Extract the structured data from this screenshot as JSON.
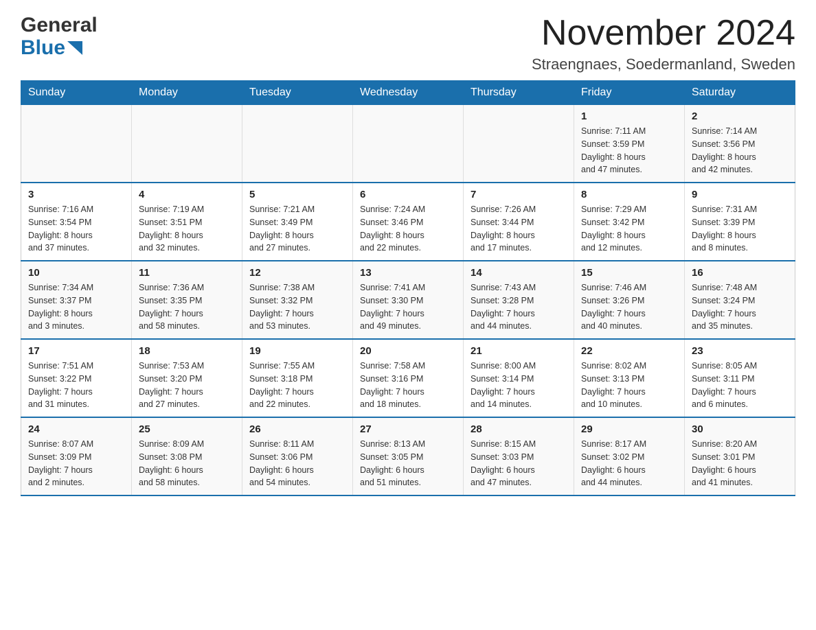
{
  "header": {
    "logo_general": "General",
    "logo_blue": "Blue",
    "month_title": "November 2024",
    "location": "Straengnaes, Soedermanland, Sweden"
  },
  "days_of_week": [
    "Sunday",
    "Monday",
    "Tuesday",
    "Wednesday",
    "Thursday",
    "Friday",
    "Saturday"
  ],
  "weeks": [
    [
      {
        "day": "",
        "info": ""
      },
      {
        "day": "",
        "info": ""
      },
      {
        "day": "",
        "info": ""
      },
      {
        "day": "",
        "info": ""
      },
      {
        "day": "",
        "info": ""
      },
      {
        "day": "1",
        "info": "Sunrise: 7:11 AM\nSunset: 3:59 PM\nDaylight: 8 hours\nand 47 minutes."
      },
      {
        "day": "2",
        "info": "Sunrise: 7:14 AM\nSunset: 3:56 PM\nDaylight: 8 hours\nand 42 minutes."
      }
    ],
    [
      {
        "day": "3",
        "info": "Sunrise: 7:16 AM\nSunset: 3:54 PM\nDaylight: 8 hours\nand 37 minutes."
      },
      {
        "day": "4",
        "info": "Sunrise: 7:19 AM\nSunset: 3:51 PM\nDaylight: 8 hours\nand 32 minutes."
      },
      {
        "day": "5",
        "info": "Sunrise: 7:21 AM\nSunset: 3:49 PM\nDaylight: 8 hours\nand 27 minutes."
      },
      {
        "day": "6",
        "info": "Sunrise: 7:24 AM\nSunset: 3:46 PM\nDaylight: 8 hours\nand 22 minutes."
      },
      {
        "day": "7",
        "info": "Sunrise: 7:26 AM\nSunset: 3:44 PM\nDaylight: 8 hours\nand 17 minutes."
      },
      {
        "day": "8",
        "info": "Sunrise: 7:29 AM\nSunset: 3:42 PM\nDaylight: 8 hours\nand 12 minutes."
      },
      {
        "day": "9",
        "info": "Sunrise: 7:31 AM\nSunset: 3:39 PM\nDaylight: 8 hours\nand 8 minutes."
      }
    ],
    [
      {
        "day": "10",
        "info": "Sunrise: 7:34 AM\nSunset: 3:37 PM\nDaylight: 8 hours\nand 3 minutes."
      },
      {
        "day": "11",
        "info": "Sunrise: 7:36 AM\nSunset: 3:35 PM\nDaylight: 7 hours\nand 58 minutes."
      },
      {
        "day": "12",
        "info": "Sunrise: 7:38 AM\nSunset: 3:32 PM\nDaylight: 7 hours\nand 53 minutes."
      },
      {
        "day": "13",
        "info": "Sunrise: 7:41 AM\nSunset: 3:30 PM\nDaylight: 7 hours\nand 49 minutes."
      },
      {
        "day": "14",
        "info": "Sunrise: 7:43 AM\nSunset: 3:28 PM\nDaylight: 7 hours\nand 44 minutes."
      },
      {
        "day": "15",
        "info": "Sunrise: 7:46 AM\nSunset: 3:26 PM\nDaylight: 7 hours\nand 40 minutes."
      },
      {
        "day": "16",
        "info": "Sunrise: 7:48 AM\nSunset: 3:24 PM\nDaylight: 7 hours\nand 35 minutes."
      }
    ],
    [
      {
        "day": "17",
        "info": "Sunrise: 7:51 AM\nSunset: 3:22 PM\nDaylight: 7 hours\nand 31 minutes."
      },
      {
        "day": "18",
        "info": "Sunrise: 7:53 AM\nSunset: 3:20 PM\nDaylight: 7 hours\nand 27 minutes."
      },
      {
        "day": "19",
        "info": "Sunrise: 7:55 AM\nSunset: 3:18 PM\nDaylight: 7 hours\nand 22 minutes."
      },
      {
        "day": "20",
        "info": "Sunrise: 7:58 AM\nSunset: 3:16 PM\nDaylight: 7 hours\nand 18 minutes."
      },
      {
        "day": "21",
        "info": "Sunrise: 8:00 AM\nSunset: 3:14 PM\nDaylight: 7 hours\nand 14 minutes."
      },
      {
        "day": "22",
        "info": "Sunrise: 8:02 AM\nSunset: 3:13 PM\nDaylight: 7 hours\nand 10 minutes."
      },
      {
        "day": "23",
        "info": "Sunrise: 8:05 AM\nSunset: 3:11 PM\nDaylight: 7 hours\nand 6 minutes."
      }
    ],
    [
      {
        "day": "24",
        "info": "Sunrise: 8:07 AM\nSunset: 3:09 PM\nDaylight: 7 hours\nand 2 minutes."
      },
      {
        "day": "25",
        "info": "Sunrise: 8:09 AM\nSunset: 3:08 PM\nDaylight: 6 hours\nand 58 minutes."
      },
      {
        "day": "26",
        "info": "Sunrise: 8:11 AM\nSunset: 3:06 PM\nDaylight: 6 hours\nand 54 minutes."
      },
      {
        "day": "27",
        "info": "Sunrise: 8:13 AM\nSunset: 3:05 PM\nDaylight: 6 hours\nand 51 minutes."
      },
      {
        "day": "28",
        "info": "Sunrise: 8:15 AM\nSunset: 3:03 PM\nDaylight: 6 hours\nand 47 minutes."
      },
      {
        "day": "29",
        "info": "Sunrise: 8:17 AM\nSunset: 3:02 PM\nDaylight: 6 hours\nand 44 minutes."
      },
      {
        "day": "30",
        "info": "Sunrise: 8:20 AM\nSunset: 3:01 PM\nDaylight: 6 hours\nand 41 minutes."
      }
    ]
  ]
}
